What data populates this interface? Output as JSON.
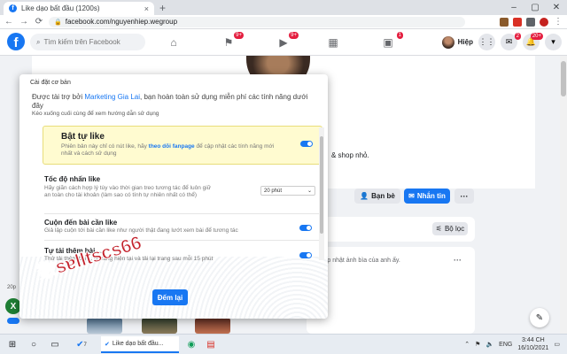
{
  "browser": {
    "tab_title": "Like dạo bất đầu (1200s)",
    "tab_close": "×",
    "new_tab": "+",
    "url": "facebook.com/nguyenhiep.wegroup",
    "back": "←",
    "forward": "→",
    "reload": "⟳",
    "win_min": "–",
    "win_max": "▢",
    "win_close": "✕"
  },
  "fb": {
    "logo": "f",
    "search_placeholder": "Tìm kiếm trên Facebook",
    "nav_badges": {
      "flag": "9+",
      "watch": "9+",
      "groups": "1"
    },
    "user_name": "Hiệp",
    "messenger_badge": "2",
    "notif_badge": "20+"
  },
  "page": {
    "bio_fragment": "& shop nhỏ.",
    "friend_button": "Bạn bè",
    "message_button": "Nhắn tin",
    "more_button": "···",
    "filter_button": "Bộ lọc",
    "post_line": "cập nhật ảnh bìa của anh ấy.",
    "post_menu": "···"
  },
  "popup": {
    "header": "Cài đặt cơ bản",
    "sponsor_prefix": "Được tài trợ bởi ",
    "sponsor_brand": "Marketing Gia Lai",
    "sponsor_suffix": ", bạn hoàn toàn sử dụng miễn phí các tính năng dưới đây",
    "hint": "Kéo xuống cuối cùng để xem hướng dẫn sử dụng",
    "rows": [
      {
        "title": "Bật tự like",
        "desc_a": "Phiên bản này chỉ có nút like, hãy ",
        "desc_link": "theo dõi fanpage",
        "desc_b": " để cập nhật các tính năng mới nhất và cách sử dụng",
        "on": true
      },
      {
        "title": "Tốc độ nhấn like",
        "desc": "Hãy giãn cách hợp lý tùy vào thời gian treo tương tác để luôn giữ an toàn cho tài khoản (làm sao có tính tự nhiên nhất có thể)",
        "select_value": "20 phút"
      },
      {
        "title": "Cuộn đến bài cần like",
        "desc": "Giả lập cuộn tới bài cần like như người thật đang lướt xem bài để tương tác",
        "on": true
      },
      {
        "title": "Tự tải thêm bài ...",
        "desc": "Thử tải thêm bài ... ở trang hiện tại và tải lại trang sau mỗi 15 phút",
        "on": true
      }
    ],
    "run_button": "Đếm lại"
  },
  "left_widget": {
    "label_a": "20p",
    "x_label": "X"
  },
  "watermark": "数sɐlltscs66",
  "taskbar": {
    "app_title": "Like dạo bất đầu...",
    "app_badge": "7",
    "lang": "ENG",
    "time": "3:44 CH",
    "date": "16/10/2021"
  }
}
